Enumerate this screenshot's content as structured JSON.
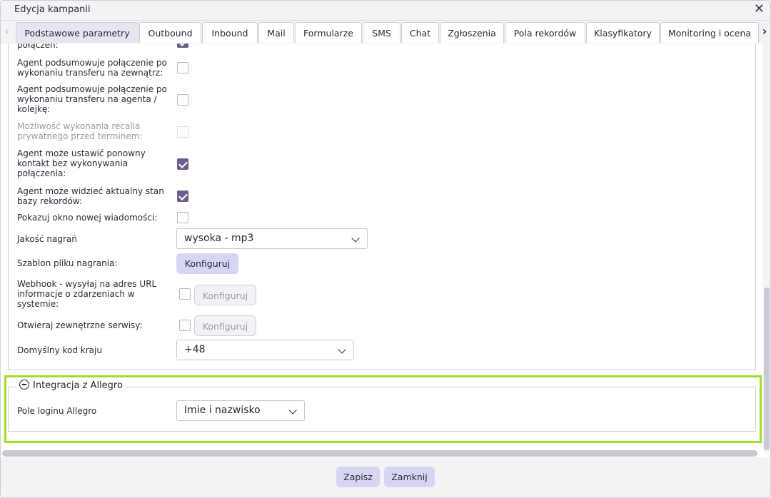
{
  "window": {
    "title": "Edycja kampanii"
  },
  "tabs": [
    {
      "label": "Podstawowe parametry",
      "active": true
    },
    {
      "label": "Outbound"
    },
    {
      "label": "Inbound"
    },
    {
      "label": "Mail"
    },
    {
      "label": "Formularze"
    },
    {
      "label": "SMS"
    },
    {
      "label": "Chat"
    },
    {
      "label": "Zgłoszenia"
    },
    {
      "label": "Pola rekordów"
    },
    {
      "label": "Klasyfikatory"
    },
    {
      "label": "Monitoring i ocena"
    }
  ],
  "settings": {
    "partial_top_label": "połączeń:",
    "rows": [
      {
        "label": "Agent podsumowuje połączenie po wykonaniu transferu na zewnątrz:",
        "checked": false
      },
      {
        "label": "Agent podsumowuje połączenie po wykonaniu transferu na agenta / kolejkę:",
        "checked": false
      },
      {
        "label": "Możliwość wykonania recalla prywatnego przed terminem:",
        "checked": false,
        "disabled": true
      },
      {
        "label": "Agent może ustawić ponowny kontakt bez wykonywania połączenia:",
        "checked": true
      },
      {
        "label": "Agent może widzieć aktualny stan bazy rekordów:",
        "checked": true
      },
      {
        "label": "Pokazuj okno nowej wiadomości:",
        "checked": false
      }
    ],
    "recording_quality": {
      "label": "Jakość nagrań",
      "value": "wysoka - mp3"
    },
    "recording_template": {
      "label": "Szablon pliku nagrania:",
      "button": "Konfiguruj"
    },
    "webhook": {
      "label": "Webhook - wysyłaj na adres URL informacje o zdarzeniach w systemie:",
      "checked": false,
      "button": "Konfiguruj"
    },
    "external_services": {
      "label": "Otwieraj zewnętrzne serwisy:",
      "checked": false,
      "button": "Konfiguruj"
    },
    "country_code": {
      "label": "Domyślny kod kraju",
      "value": "+48"
    }
  },
  "allegro": {
    "legend": "Integracja z Allegro",
    "login_field": {
      "label": "Pole loginu Allegro",
      "value": "Imie i nazwisko"
    }
  },
  "footer": {
    "save": "Zapisz",
    "close": "Zamknij"
  },
  "colors": {
    "accent_check": "#6e5e8d",
    "primary_button": "#d6d6f2",
    "highlight": "#9fdf2a"
  },
  "icons": {
    "close": "close-icon",
    "tab_prev": "chevron-left-icon",
    "tab_next": "chevron-right-icon",
    "collapse": "minus-circle-icon",
    "dropdown": "chevron-down-icon",
    "check": "checkmark-icon"
  }
}
